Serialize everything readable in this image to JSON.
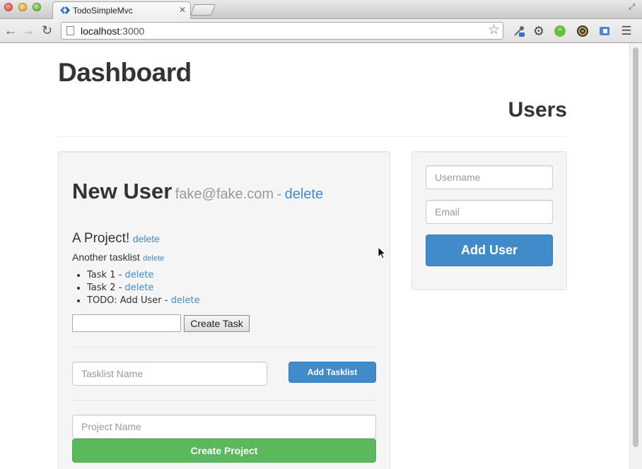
{
  "browser": {
    "tab_title": "TodoSimpleMvc",
    "tab_close": "✕",
    "url_host": "localhost",
    "url_port": ":3000",
    "extensions": [
      "eyedropper-icon",
      "gear-icon",
      "quote-icon",
      "color-wheel-icon",
      "puzzle-icon",
      "menu-icon"
    ]
  },
  "page": {
    "title": "Dashboard",
    "sidebar_title": "Users"
  },
  "user": {
    "name": "New User",
    "email": "fake@fake.com",
    "separator": "-",
    "delete_label": "delete"
  },
  "project": {
    "name": "A Project!",
    "delete_label": "delete",
    "tasklist": {
      "name": "Another tasklist",
      "delete_label": "delete",
      "tasks": [
        {
          "text": "Task 1",
          "sep": "-",
          "delete_label": "delete"
        },
        {
          "text": "Task 2",
          "sep": "-",
          "delete_label": "delete"
        },
        {
          "text": "TODO: Add User",
          "sep": "-",
          "delete_label": "delete"
        }
      ],
      "new_task_value": "",
      "create_task_label": "Create Task"
    }
  },
  "forms": {
    "tasklist_name_placeholder": "Tasklist Name",
    "add_tasklist_label": "Add Tasklist",
    "project_name_placeholder": "Project Name",
    "create_project_label": "Create Project",
    "username_placeholder": "Username",
    "email_placeholder": "Email",
    "add_user_label": "Add User"
  },
  "colors": {
    "link": "#428bca",
    "primary": "#428bca",
    "success": "#5cb85c"
  }
}
